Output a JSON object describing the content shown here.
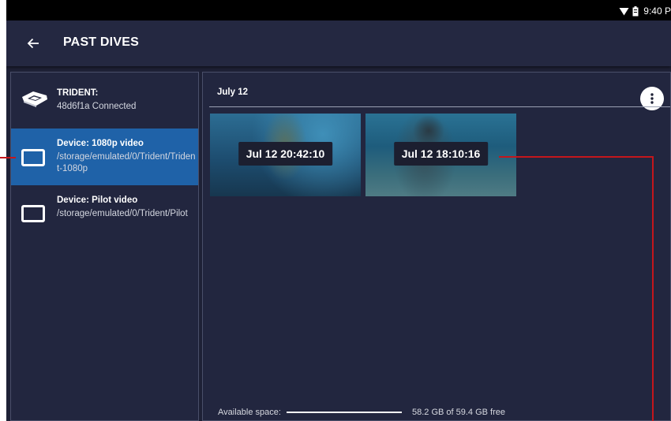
{
  "status_bar": {
    "time": "9:40 P",
    "icons": [
      "wifi-icon",
      "battery-icon"
    ]
  },
  "header": {
    "back_icon": "arrow-left-icon",
    "title": "PAST DIVES"
  },
  "sidebar": {
    "items": [
      {
        "title": "TRIDENT:",
        "subtitle": "48d6f1a Connected",
        "icon": "drone-icon",
        "selected": false
      },
      {
        "title": "Device: 1080p video",
        "subtitle": "/storage/emulated/0/Trident/Trident-1080p",
        "icon": "device-icon",
        "selected": true
      },
      {
        "title": "Device: Pilot video",
        "subtitle": "/storage/emulated/0/Trident/Pilot",
        "icon": "device-icon",
        "selected": false
      }
    ]
  },
  "content": {
    "date_header": "July 12",
    "more_icon": "more-vert-icon",
    "dives": [
      {
        "label": "Jul 12 20:42:10"
      },
      {
        "label": "Jul 12 18:10:16"
      }
    ],
    "storage": {
      "label": "Available space:",
      "value": "58.2 GB of 59.4 GB free",
      "used_fraction": 0.02
    }
  },
  "colors": {
    "background": "#1e2136",
    "app_bar": "#242841",
    "selected": "#1f62a8",
    "callout": "#c4161c"
  }
}
